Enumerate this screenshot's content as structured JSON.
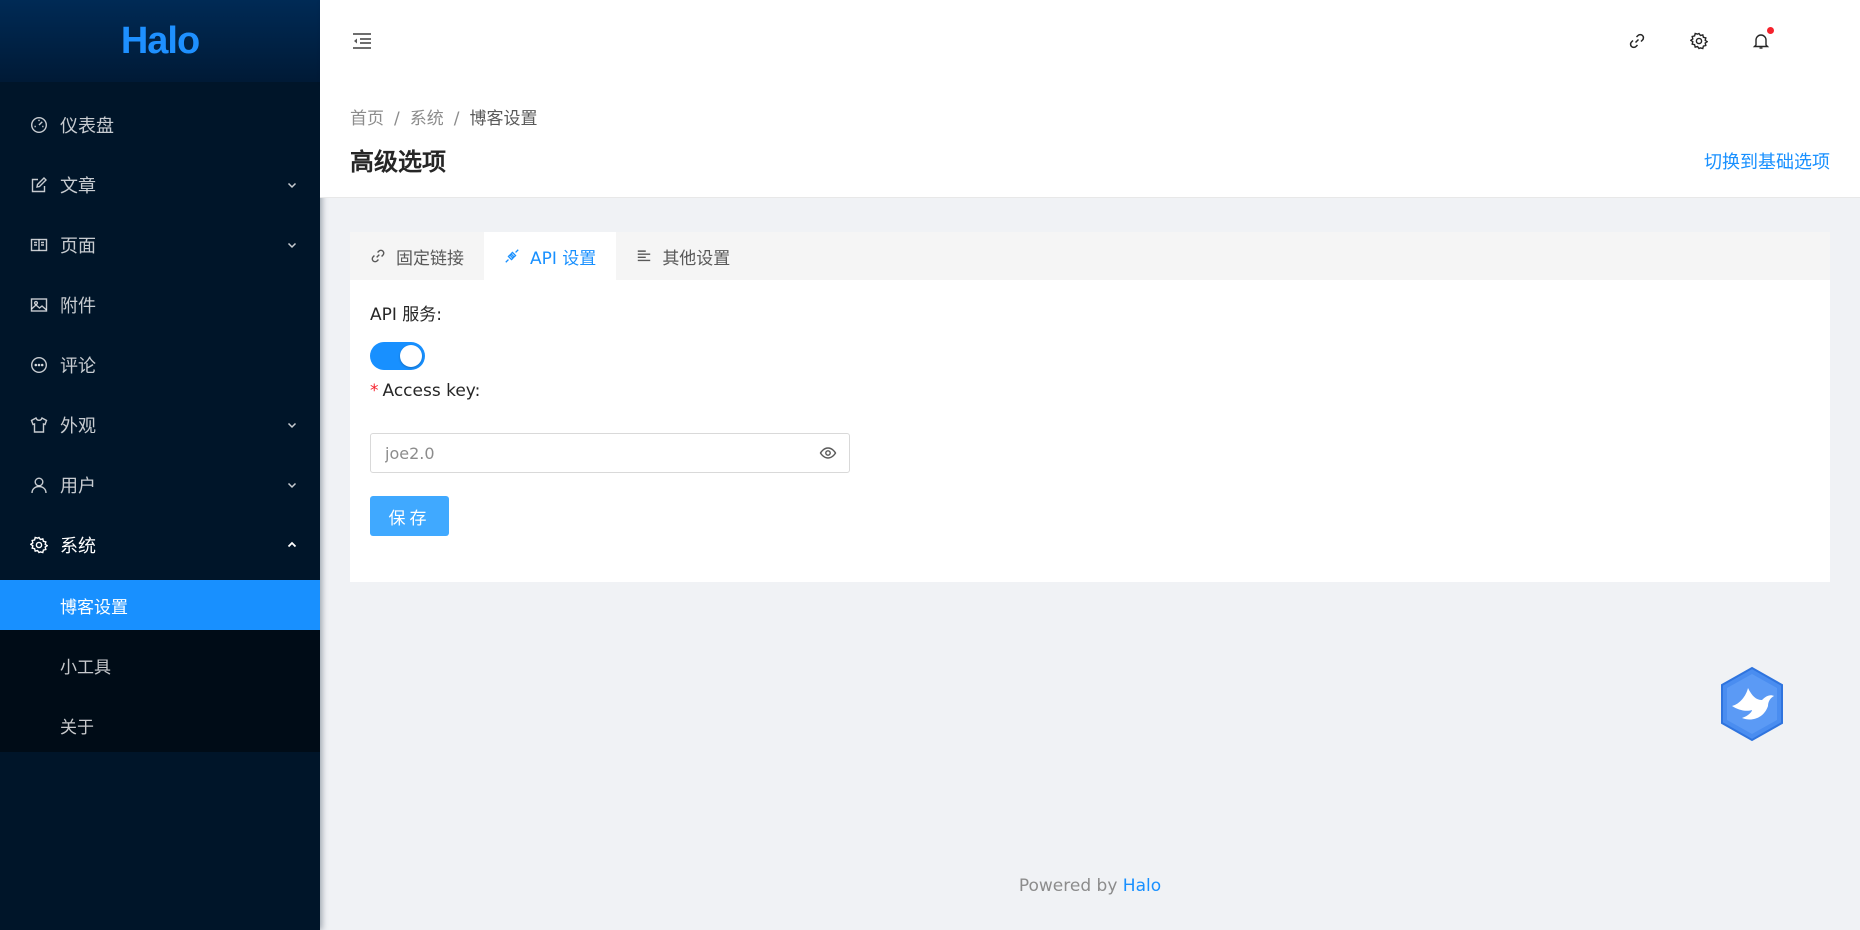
{
  "brand": {
    "logo_text": "Halo",
    "accent": "#1890ff",
    "sidebar_bg": "#001529"
  },
  "sidebar": {
    "items": [
      {
        "label": "仪表盘",
        "icon": "dashboard-icon",
        "has_arrow": false
      },
      {
        "label": "文章",
        "icon": "edit-icon",
        "has_arrow": true
      },
      {
        "label": "页面",
        "icon": "book-icon",
        "has_arrow": true
      },
      {
        "label": "附件",
        "icon": "picture-icon",
        "has_arrow": false
      },
      {
        "label": "评论",
        "icon": "message-icon",
        "has_arrow": false
      },
      {
        "label": "外观",
        "icon": "skin-icon",
        "has_arrow": true
      },
      {
        "label": "用户",
        "icon": "user-icon",
        "has_arrow": true
      },
      {
        "label": "系统",
        "icon": "setting-icon",
        "has_arrow": true,
        "open": true
      }
    ],
    "sub_items": [
      {
        "label": "博客设置",
        "active": true
      },
      {
        "label": "小工具",
        "active": false
      },
      {
        "label": "关于",
        "active": false
      }
    ]
  },
  "header": {
    "trigger_icon": "menu-fold-icon",
    "actions": [
      "link-icon",
      "setting-icon",
      "bell-icon"
    ],
    "has_notification": true
  },
  "breadcrumb": {
    "items": [
      "首页",
      "系统",
      "博客设置"
    ],
    "separator": "/"
  },
  "page": {
    "title": "高级选项",
    "switch_label": "切换到基础选项"
  },
  "tabs": [
    {
      "label": "固定链接",
      "icon": "link-icon",
      "active": false
    },
    {
      "label": "API 设置",
      "icon": "api-icon",
      "active": true
    },
    {
      "label": "其他设置",
      "icon": "align-left-icon",
      "active": false
    }
  ],
  "form": {
    "api_service_label": "API 服务:",
    "api_enabled": true,
    "access_key_required_mark": "*",
    "access_key_label": "Access key:",
    "access_key_value": "joe2.0",
    "save_label": "保存"
  },
  "footer": {
    "prefix": "Powered by ",
    "link": "Halo"
  }
}
